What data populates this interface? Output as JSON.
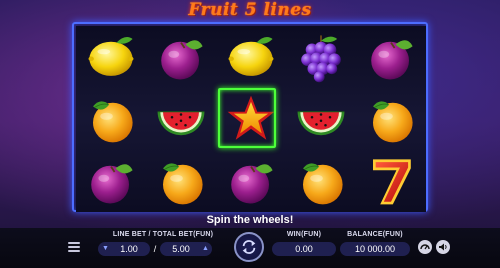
{
  "game": {
    "logo_text": "Fruit 5 lines"
  },
  "reels": [
    {
      "symbols": [
        "lemon",
        "orange",
        "plum"
      ]
    },
    {
      "symbols": [
        "plum",
        "watermelon",
        "orange"
      ]
    },
    {
      "symbols": [
        "lemon",
        "star",
        "plum"
      ]
    },
    {
      "symbols": [
        "grapes",
        "watermelon",
        "orange"
      ]
    },
    {
      "symbols": [
        "plum",
        "orange",
        "seven"
      ]
    }
  ],
  "winning_symbol": "star",
  "message": "Spin the wheels!",
  "controls": {
    "line_bet_label": "LINE BET / TOTAL BET(FUN)",
    "line_bet_value": "1.00",
    "separator": "/",
    "total_bet_value": "5.00",
    "win_label": "WIN(FUN)",
    "win_value": "0.00",
    "balance_label": "BALANCE(FUN)",
    "balance_value": "10 000.00",
    "decrease_glyph": "▼",
    "increase_glyph": "▲"
  },
  "icons": {
    "menu": "menu-icon",
    "spin": "spin-arrows-icon",
    "speed": "speedometer-icon",
    "sound": "sound-icon"
  },
  "colors": {
    "frame_border": "#4d6dff",
    "win_highlight": "#4dff3a",
    "logo": "#ff7a1a"
  }
}
